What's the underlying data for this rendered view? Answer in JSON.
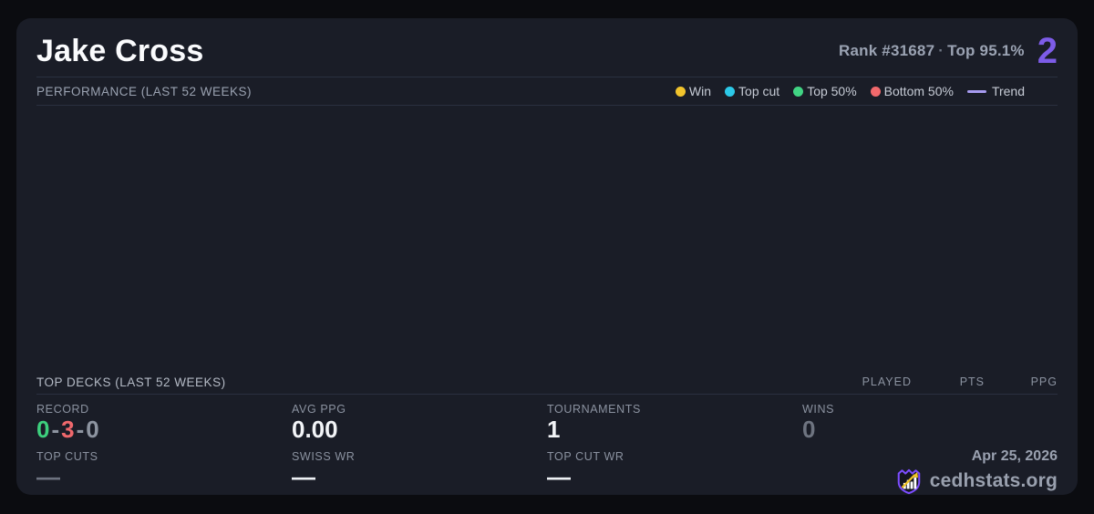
{
  "player": {
    "name": "Jake Cross",
    "rank_label": "Rank #31687",
    "separator": "·",
    "top_percent_label": "Top 95.1%",
    "score": "2"
  },
  "performance": {
    "title": "PERFORMANCE (LAST 52 WEEKS)",
    "chart_empty": true,
    "legend": [
      {
        "label": "Win",
        "color": "#f2c42c",
        "type": "dot"
      },
      {
        "label": "Top cut",
        "color": "#2cc9e8",
        "type": "dot"
      },
      {
        "label": "Top 50%",
        "color": "#41d483",
        "type": "dot"
      },
      {
        "label": "Bottom 50%",
        "color": "#f2696c",
        "type": "dot"
      },
      {
        "label": "Trend",
        "color": "#a79bf0",
        "type": "line"
      }
    ]
  },
  "top_decks": {
    "title": "TOP DECKS (LAST 52 WEEKS)",
    "columns": [
      "PLAYED",
      "PTS",
      "PPG"
    ],
    "rows": []
  },
  "stats": {
    "record": {
      "label": "RECORD",
      "wins": "0",
      "losses": "3",
      "draws": "0",
      "sep": "-"
    },
    "avg_ppg": {
      "label": "AVG PPG",
      "value": "0.00"
    },
    "tournaments": {
      "label": "TOURNAMENTS",
      "value": "1"
    },
    "wins": {
      "label": "WINS",
      "value": "0"
    },
    "top_cuts": {
      "label": "TOP CUTS",
      "value": "—"
    },
    "swiss_wr": {
      "label": "SWISS WR",
      "value": "—"
    },
    "top_cut_wr": {
      "label": "TOP CUT WR",
      "value": "—"
    }
  },
  "footer": {
    "date": "Apr 25, 2026",
    "brand": "cedhstats.org"
  },
  "colors": {
    "page_bg": "#0b0c10",
    "card_bg": "#1a1d27",
    "accent_purple": "#7d5ce8",
    "trend_purple": "#a79bf0",
    "win_yellow": "#f2c42c",
    "top_cut_cyan": "#2cc9e8",
    "top50_green": "#41d483",
    "bottom50_red": "#f2696c",
    "record_win": "#3dcf7d",
    "record_loss": "#ef686c",
    "record_neutral": "#8d94a0",
    "muted_value": "#6e7480",
    "dash_muted": "#6d7380",
    "dash_bright": "#eef1f5",
    "logo_purple": "#7c4dff",
    "logo_yellow": "#f0c428"
  }
}
